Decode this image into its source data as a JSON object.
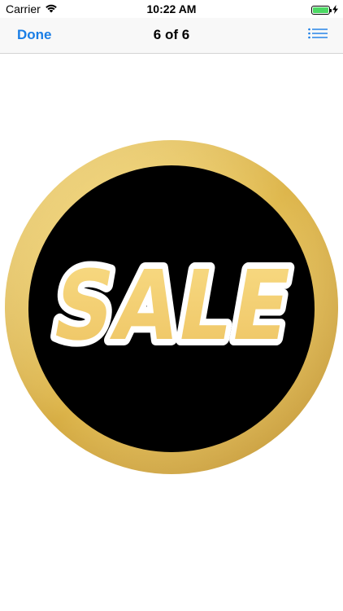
{
  "status_bar": {
    "carrier": "Carrier",
    "time": "10:22 AM",
    "battery_percent": 100,
    "icons": [
      "wifi-icon",
      "battery-icon",
      "charging-bolt-icon"
    ]
  },
  "nav": {
    "done_label": "Done",
    "title": "6 of 6",
    "list_icon": "list-icon"
  },
  "image": {
    "text": "SALE",
    "colors": {
      "gold": "#e8c45a",
      "dark": "#000000",
      "outline": "#ffffff",
      "letter_fill": "#f4d072"
    }
  },
  "colors": {
    "accent": "#1a7ee6",
    "battery_green": "#4cd964"
  }
}
